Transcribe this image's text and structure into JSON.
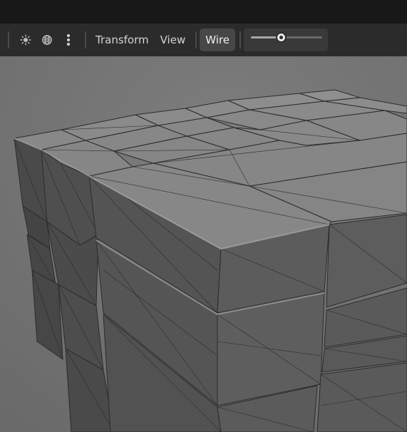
{
  "toolbar": {
    "icons": [
      "sun-icon",
      "globe-icon",
      "more-vertical-icon"
    ],
    "menu_transform": "Transform",
    "menu_view": "View",
    "wire_button": "Wire",
    "slider_value": 0.42
  },
  "colors": {
    "titlebar": "#181818",
    "toolbar": "#2b2b2b",
    "active_button": "#474747",
    "viewport_bg": "#727272",
    "mesh_face": "#6e6e6e",
    "wire": "#2c2c2c"
  }
}
